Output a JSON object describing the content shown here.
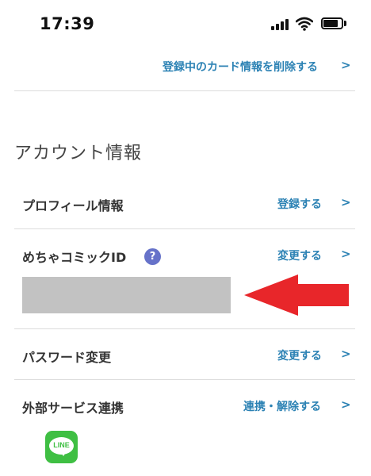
{
  "status_bar": {
    "time": "17:39"
  },
  "card": {
    "delete_link": "登録中のカード情報を削除する"
  },
  "chevron": ">",
  "account": {
    "section_title": "アカウント情報",
    "profile": {
      "label": "プロフィール情報",
      "action": "登録する"
    },
    "comic_id": {
      "label": "めちゃコミックID",
      "help": "?",
      "action": "変更する"
    },
    "password": {
      "label": "パスワード変更",
      "action": "変更する"
    },
    "external": {
      "label": "外部サービス連携",
      "action": "連携・解除する",
      "services": [
        "LINE"
      ]
    }
  },
  "colors": {
    "accent": "#2c82b4",
    "help_icon": "#6672c9",
    "annotation_arrow": "#e8262a",
    "line_green": "#3fbf43"
  }
}
